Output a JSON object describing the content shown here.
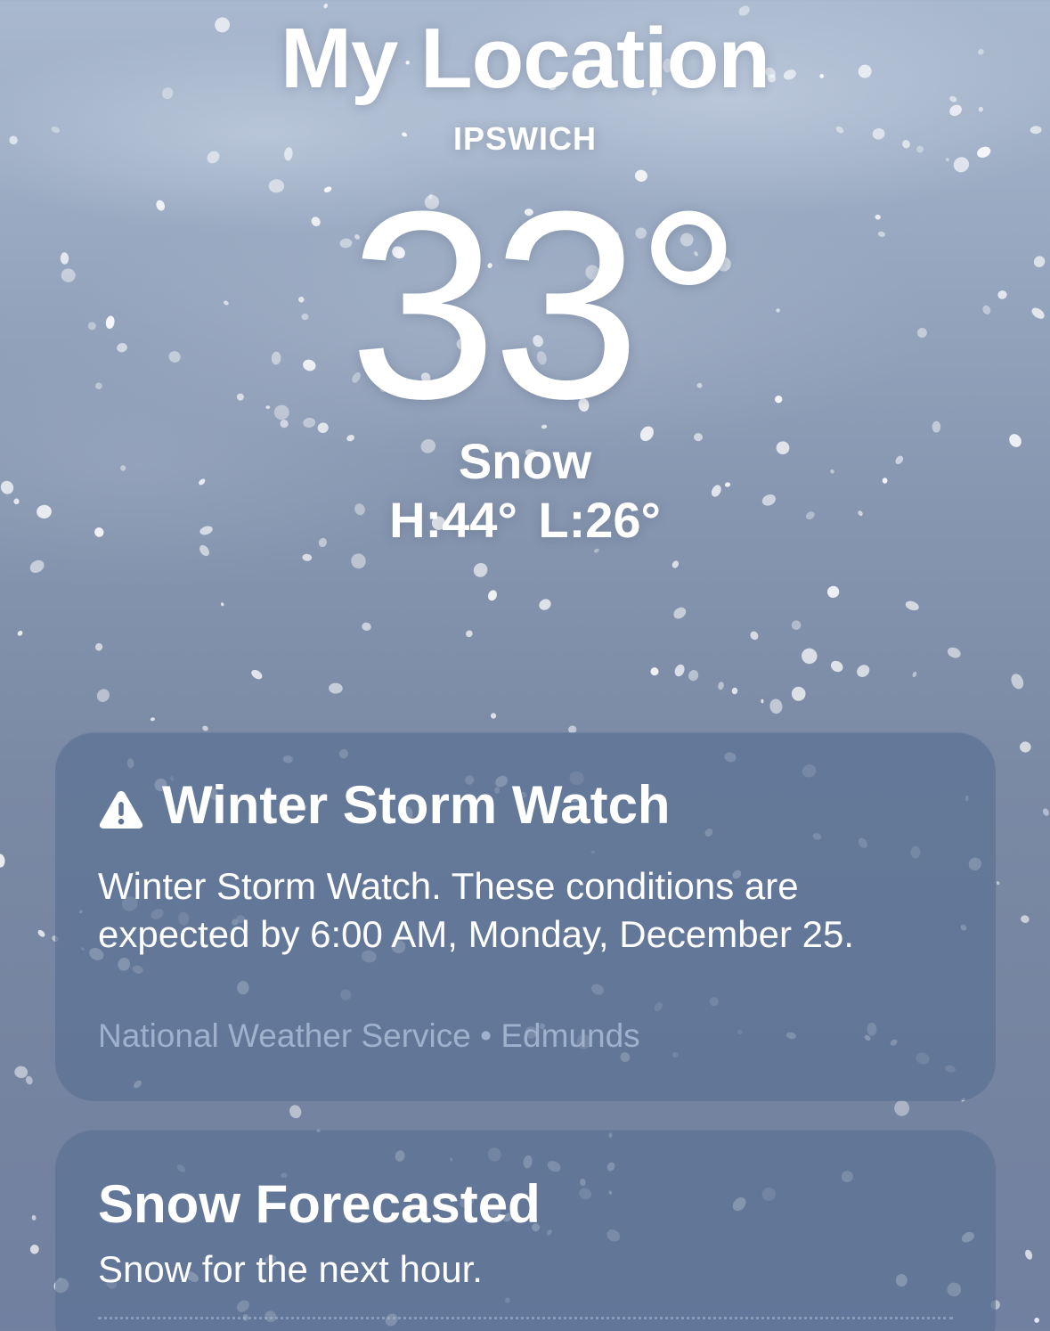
{
  "header": {
    "title": "My Location",
    "subtitle": "IPSWICH",
    "temperature": "33°",
    "condition": "Snow",
    "high_low": "H:44°  L:26°"
  },
  "alert_card": {
    "icon": "warning-triangle-icon",
    "title": "Winter Storm Watch",
    "body": "Winter Storm Watch. These conditions are expected by 6:00 AM, Monday, December 25.",
    "source": "National Weather Service • Edmunds"
  },
  "forecast_card": {
    "title": "Snow Forecasted",
    "body": "Snow for the next hour."
  },
  "colors": {
    "sky_top": "#a9b8ce",
    "sky_bottom": "#7180a0",
    "card_bg": "#5c7194",
    "source_text": "#9fb1cc",
    "text": "#ffffff"
  }
}
